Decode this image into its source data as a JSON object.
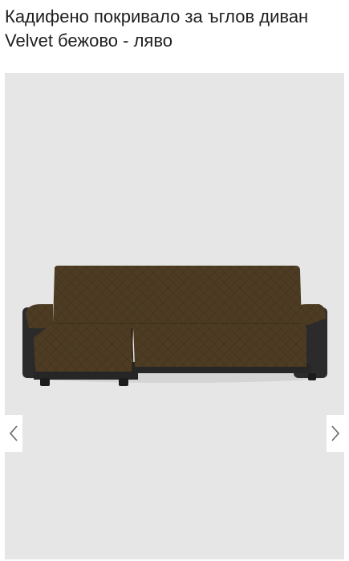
{
  "product": {
    "title": "Кадифено покривало за ъглов диван Velvet бежово - ляво"
  },
  "gallery": {
    "image_alt": "corner sofa with quilted brown velvet cover",
    "prev_icon": "chevron-left-icon",
    "next_icon": "chevron-right-icon"
  },
  "colors": {
    "background": "#ffffff",
    "gallery_bg": "#e6e6e6",
    "cover_brown": "#4a3a22",
    "sofa_black": "#2a2a2a"
  }
}
